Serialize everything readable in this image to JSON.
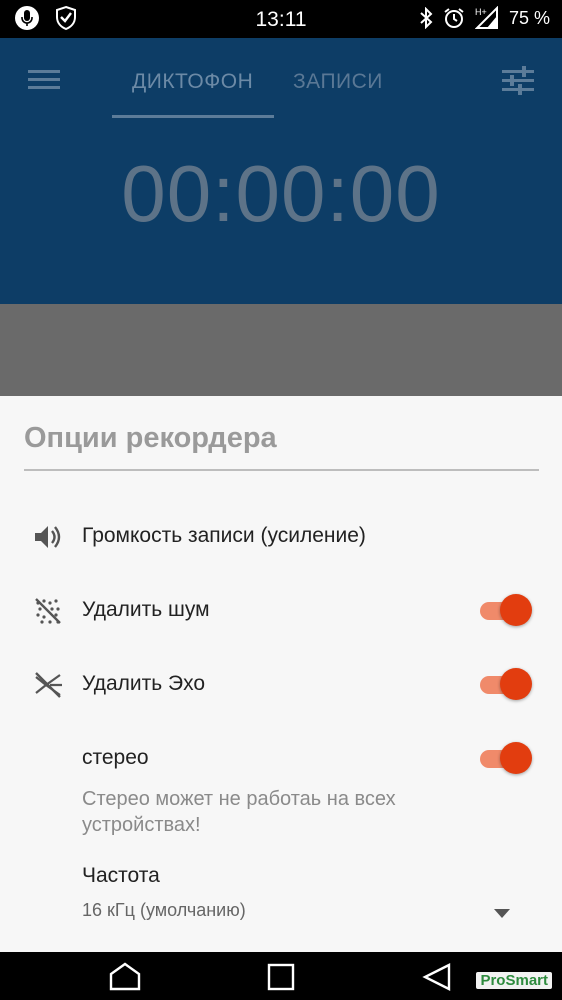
{
  "status_bar": {
    "time": "13:11",
    "battery": "75 %",
    "network": "H+",
    "left_icons": [
      "microphone-icon",
      "shield-check-icon"
    ],
    "right_icons": [
      "bluetooth-icon",
      "alarm-icon",
      "signal-icon",
      "battery-icon"
    ]
  },
  "header": {
    "tabs": [
      {
        "label": "ДИКТОФОН",
        "active": true
      },
      {
        "label": "ЗАПИСИ",
        "active": false
      }
    ],
    "timer": "00:00:00",
    "background": "#0d3d66"
  },
  "sheet": {
    "title": "Опции рекордера",
    "options": [
      {
        "label": "Громкость записи (усиление)",
        "icon": "volume-icon"
      },
      {
        "label": "Удалить шум",
        "icon": "noise-off-icon",
        "toggle": true
      },
      {
        "label": "Удалить Эхо",
        "icon": "echo-off-icon",
        "toggle": true
      },
      {
        "label": "стерео",
        "toggle": true
      }
    ],
    "stereo_note": "Стерео может не работаь на всех устройствах!",
    "frequency": {
      "label": "Частота",
      "value": "16 кГц (умолчанию)"
    },
    "accent_color": "#e23d0f"
  },
  "navigation": {
    "buttons": [
      "home-icon",
      "recents-icon",
      "back-icon"
    ],
    "watermark": "ProSmart"
  }
}
